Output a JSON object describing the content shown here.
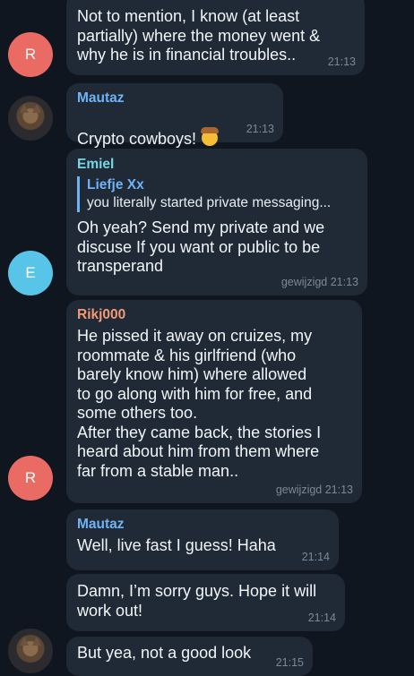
{
  "messages": [
    {
      "text": "Not to mention, I know (at least\npartially) where the money went &\nwhy he is in financial troubles..",
      "time": "21:13"
    },
    {
      "sender": "Mautaz",
      "sender_color": "#6fb3f5",
      "text": "Crypto cowboys!",
      "emoji": "cowboy-face-emoji",
      "time": "21:13"
    },
    {
      "sender": "Emiel",
      "sender_color": "#74d7e3",
      "reply": {
        "name": "Liefje Xx",
        "text": "you literally started private messaging..."
      },
      "text": "Oh yeah? Send my private and we\ndiscuse If you want or public to be\ntransperand",
      "time": "gewijzigd 21:13"
    },
    {
      "sender": "Rikj000",
      "sender_color": "#f29a76",
      "text": "He pissed it away on cruizes, my\nroommate & his girlfriend (who\nbarely know him) where allowed\nto go along with him for free, and\nsome others too.\nAfter they came back, the stories I\nheard about him from them where\nfar from a stable man..",
      "time": "gewijzigd 21:13"
    },
    {
      "sender": "Mautaz",
      "sender_color": "#6fb3f5",
      "text": "Well, live fast I guess! Haha",
      "time": "21:14"
    },
    {
      "text": "Damn, I’m sorry guys. Hope it will\nwork out!",
      "time": "21:14"
    },
    {
      "text": "But yea, not a good look",
      "time": "21:15"
    }
  ],
  "avatars": {
    "r_top": {
      "letter": "R",
      "color": "#ea6b63"
    },
    "cat_top": {
      "icon": "cat-photo-avatar"
    },
    "e": {
      "letter": "E",
      "color": "#58c4e8"
    },
    "r_bottom": {
      "letter": "R",
      "color": "#ea6b63"
    },
    "cat_bottom": {
      "icon": "cat-photo-avatar"
    }
  }
}
